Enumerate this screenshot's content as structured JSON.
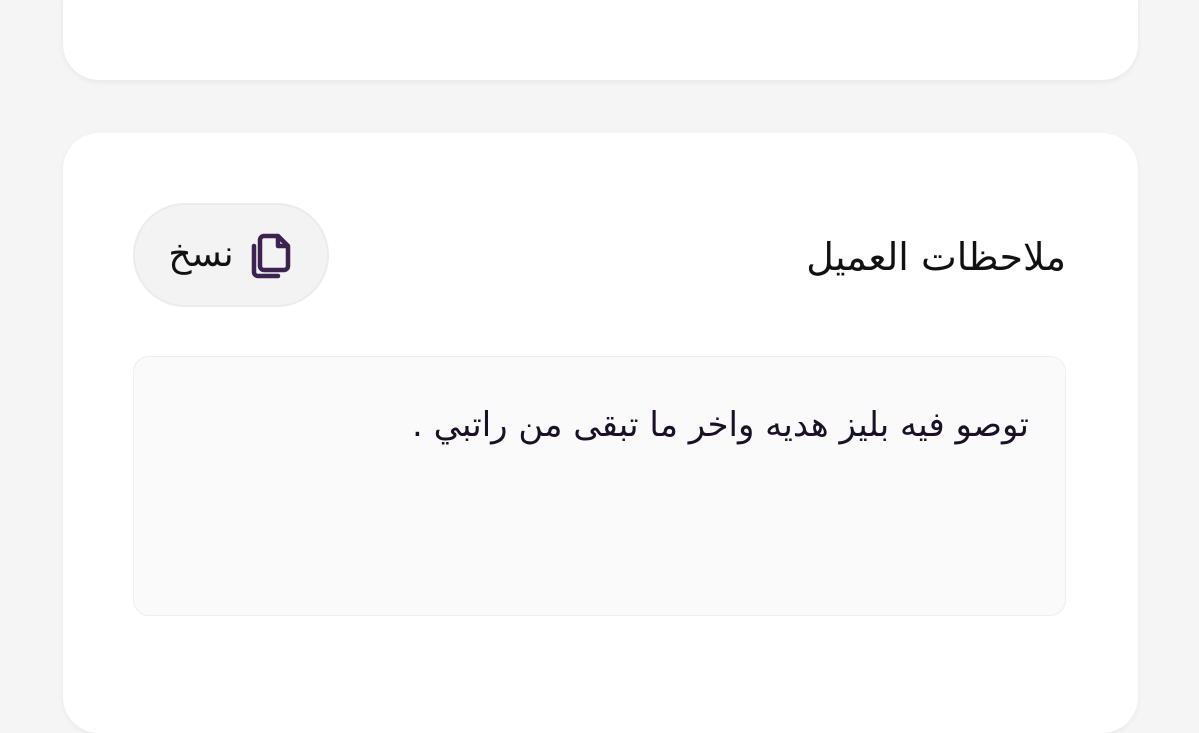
{
  "customer_notes": {
    "title": "ملاحظات العميل",
    "copy_label": "نسخ",
    "copy_icon": "copy-icon",
    "note_text": "توصو فيه بليز هديه واخر ما تبقى من راتبي ."
  },
  "colors": {
    "page_background": "#f5f5f5",
    "card_background": "#ffffff",
    "accent_icon": "#3d2150",
    "notes_box_background": "#fafafa"
  }
}
